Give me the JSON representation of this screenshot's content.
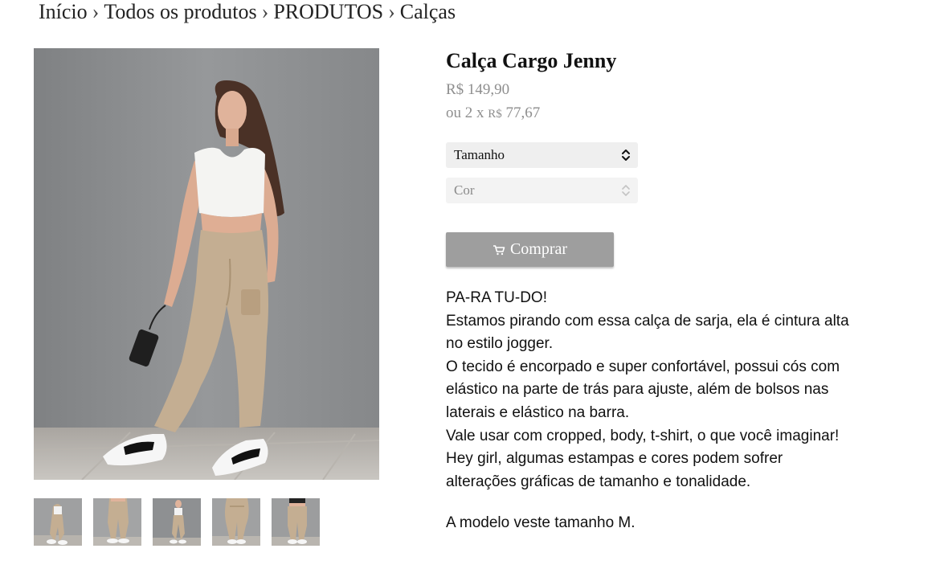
{
  "breadcrumb": {
    "items": [
      "Início",
      "Todos os produtos",
      "PRODUTOS",
      "Calças"
    ],
    "separator": "›"
  },
  "product": {
    "title": "Calça Cargo Jenny",
    "price": "R$ 149,90",
    "installments": {
      "prefix": "ou 2 x",
      "currency": "R$",
      "value": "77,67"
    }
  },
  "variants": {
    "size_label": "Tamanho",
    "color_label": "Cor"
  },
  "buy_button": {
    "label": "Comprar",
    "icon": "cart-icon"
  },
  "description": {
    "lines": [
      "PA-RA TU-DO!",
      "Estamos pirando com essa calça de sarja, ela é cintura alta no estilo jogger.",
      "O tecido é encorpado e super confortável, possui cós com elástico na parte de trás para ajuste, além de bolsos nas laterais e elástico na barra.",
      "Vale usar com cropped, body, t-shirt, o que você imaginar!",
      "Hey girl, algumas estampas e cores podem sofrer alterações gráficas de tamanho e tonalidade."
    ],
    "model_note": "A modelo veste tamanho M."
  },
  "gallery": {
    "thumbnail_count": 5
  },
  "colors": {
    "price_text": "#8e8e8e",
    "button_bg": "#9e9e9e",
    "select_bg": "#efefef",
    "wall": "#8d8f91",
    "pants": "#c4ae92"
  }
}
